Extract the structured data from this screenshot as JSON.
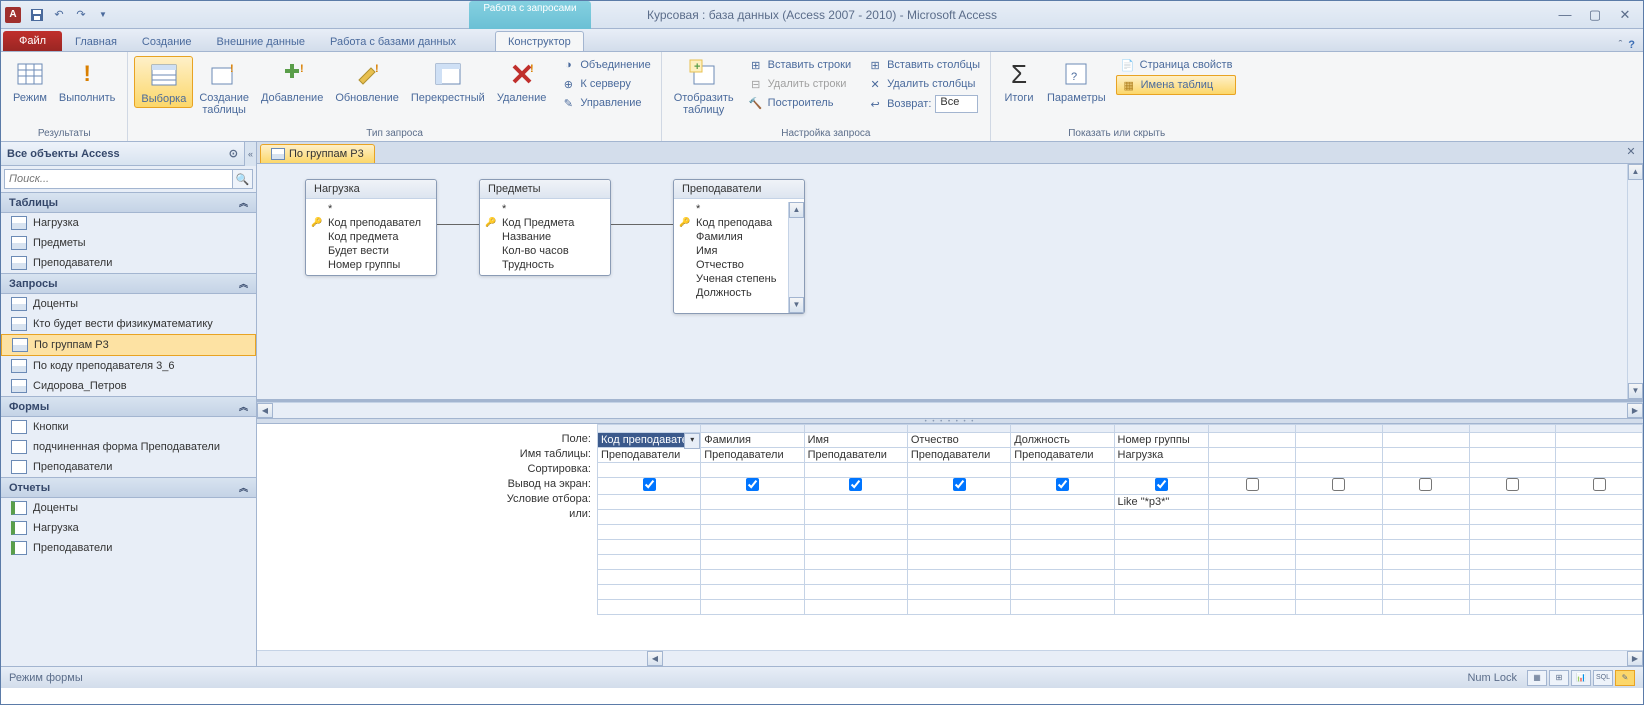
{
  "window": {
    "title": "Курсовая : база данных (Access 2007 - 2010) - Microsoft Access",
    "contextual_group": "Работа с запросами"
  },
  "tabs": {
    "file": "Файл",
    "home": "Главная",
    "create": "Создание",
    "external": "Внешние данные",
    "dbtools": "Работа с базами данных",
    "design": "Конструктор"
  },
  "ribbon": {
    "results": {
      "label": "Результаты",
      "view": "Режим",
      "run": "Выполнить"
    },
    "qtype": {
      "label": "Тип запроса",
      "select": "Выборка",
      "maketable": "Создание\nтаблицы",
      "append": "Добавление",
      "update": "Обновление",
      "crosstab": "Перекрестный",
      "delete": "Удаление",
      "union": "Объединение",
      "passthrough": "К серверу",
      "datadef": "Управление"
    },
    "setup": {
      "label": "Настройка запроса",
      "showtable": "Отобразить\nтаблицу",
      "insrows": "Вставить строки",
      "delrows": "Удалить строки",
      "builder": "Построитель",
      "inscols": "Вставить столбцы",
      "delcols": "Удалить столбцы",
      "return": "Возврат:",
      "return_val": "Все"
    },
    "showhide": {
      "label": "Показать или скрыть",
      "totals": "Итоги",
      "params": "Параметры",
      "propsheet": "Страница свойств",
      "tablenames": "Имена таблиц"
    }
  },
  "nav": {
    "header": "Все объекты Access",
    "search_ph": "Поиск...",
    "cats": {
      "tables": "Таблицы",
      "queries": "Запросы",
      "forms": "Формы",
      "reports": "Отчеты"
    },
    "tables": [
      "Нагрузка",
      "Предметы",
      "Преподаватели"
    ],
    "queries": [
      "Доценты",
      "Кто будет вести физикуматематику",
      "По группам Р3",
      "По коду преподавателя 3_6",
      "Сидорова_Петров"
    ],
    "forms": [
      "Кнопки",
      "подчиненная форма Преподаватели",
      "Преподаватели"
    ],
    "reports": [
      "Доценты",
      "Нагрузка",
      "Преподаватели"
    ]
  },
  "doc": {
    "tab": "По группам Р3"
  },
  "diagram": {
    "t1": {
      "title": "Нагрузка",
      "fields": [
        "*",
        "Код преподавател",
        "Код предмета",
        "Будет вести",
        "Номер группы"
      ],
      "key_idx": 1
    },
    "t2": {
      "title": "Предметы",
      "fields": [
        "*",
        "Код Предмета",
        "Название",
        "Кол-во часов",
        "Трудность"
      ],
      "key_idx": 1
    },
    "t3": {
      "title": "Преподаватели",
      "fields": [
        "*",
        "Код преподава",
        "Фамилия",
        "Имя",
        "Отчество",
        "Ученая степень",
        "Должность"
      ],
      "key_idx": 1
    }
  },
  "grid": {
    "rows": {
      "field": "Поле:",
      "table": "Имя таблицы:",
      "sort": "Сортировка:",
      "show": "Вывод на экран:",
      "criteria": "Условие отбора:",
      "or": "или:"
    },
    "cols": [
      {
        "field": "Код преподавате",
        "table": "Преподаватели",
        "show": true,
        "criteria": "",
        "sel": true
      },
      {
        "field": "Фамилия",
        "table": "Преподаватели",
        "show": true,
        "criteria": ""
      },
      {
        "field": "Имя",
        "table": "Преподаватели",
        "show": true,
        "criteria": ""
      },
      {
        "field": "Отчество",
        "table": "Преподаватели",
        "show": true,
        "criteria": ""
      },
      {
        "field": "Должность",
        "table": "Преподаватели",
        "show": true,
        "criteria": ""
      },
      {
        "field": "Номер группы",
        "table": "Нагрузка",
        "show": true,
        "criteria": "Like \"*р3*\""
      },
      {
        "field": "",
        "table": "",
        "show": false,
        "criteria": ""
      },
      {
        "field": "",
        "table": "",
        "show": false,
        "criteria": ""
      },
      {
        "field": "",
        "table": "",
        "show": false,
        "criteria": ""
      },
      {
        "field": "",
        "table": "",
        "show": false,
        "criteria": ""
      },
      {
        "field": "",
        "table": "",
        "show": false,
        "criteria": ""
      }
    ]
  },
  "status": {
    "left": "Режим формы",
    "numlock": "Num Lock"
  }
}
